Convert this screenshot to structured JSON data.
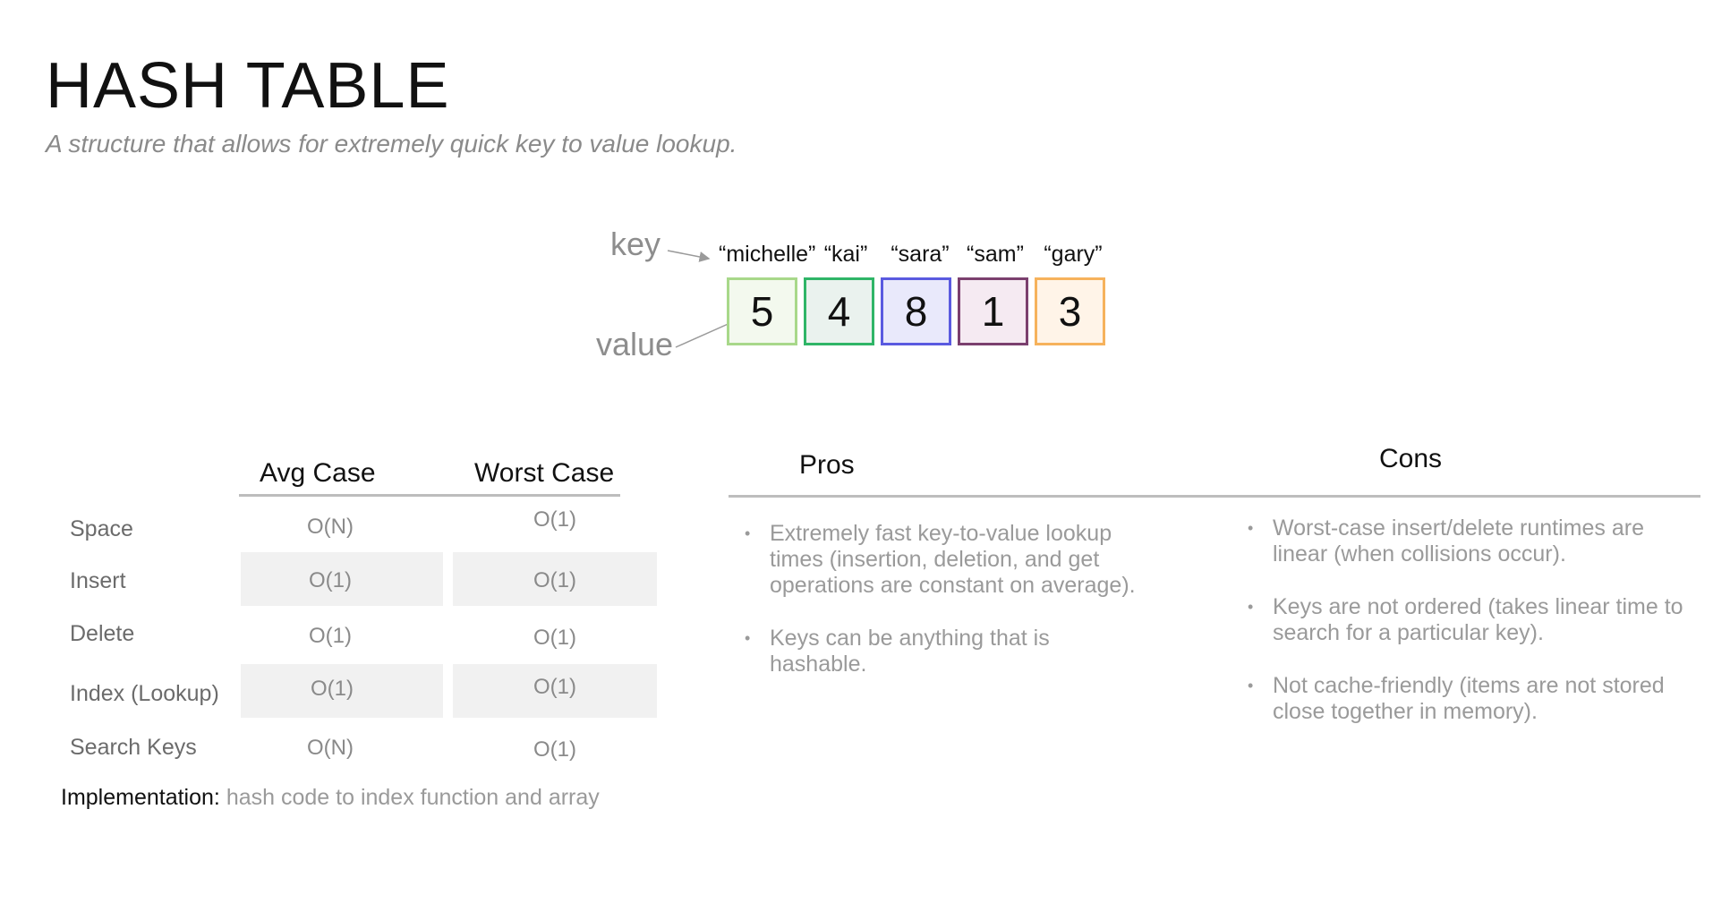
{
  "header": {
    "title": "HASH TABLE",
    "subtitle": "A structure that allows for extremely quick key to value lookup."
  },
  "diagram": {
    "key_label": "key",
    "value_label": "value",
    "entries": [
      {
        "key": "“michelle”",
        "value": "5",
        "color": "#a8d88a",
        "fill": "#f3f9ee"
      },
      {
        "key": "“kai”",
        "value": "4",
        "color": "#2fb567",
        "fill": "#eaf2ee"
      },
      {
        "key": "“sara”",
        "value": "8",
        "color": "#5a5ae0",
        "fill": "#e9e9fb"
      },
      {
        "key": "“sam”",
        "value": "1",
        "color": "#7b3f6e",
        "fill": "#f5eaf2"
      },
      {
        "key": "“gary”",
        "value": "3",
        "color": "#f6b25c",
        "fill": "#fff4e8"
      }
    ]
  },
  "complexity": {
    "col_avg": "Avg Case",
    "col_worst": "Worst Case",
    "rows": [
      {
        "label": "Space",
        "avg": "O(N)",
        "worst": "O(1)"
      },
      {
        "label": "Insert",
        "avg": "O(1)",
        "worst": "O(1)"
      },
      {
        "label": "Delete",
        "avg": "O(1)",
        "worst": "O(1)"
      },
      {
        "label": "Index (Lookup)",
        "avg": "O(1)",
        "worst": "O(1)"
      },
      {
        "label": "Search Keys",
        "avg": "O(N)",
        "worst": "O(1)"
      }
    ],
    "implementation_label": "Implementation:",
    "implementation_text": "hash code to index function and array"
  },
  "pros": {
    "heading": "Pros",
    "items": [
      "Extremely fast key-to-value lookup times (insertion, deletion, and get operations are constant on average).",
      "Keys can be anything that is hashable."
    ]
  },
  "cons": {
    "heading": "Cons",
    "items": [
      "Worst-case insert/delete runtimes are linear (when collisions occur).",
      "Keys are not ordered (takes linear time to search for a particular key).",
      "Not cache-friendly (items are not stored close together in memory)."
    ]
  }
}
